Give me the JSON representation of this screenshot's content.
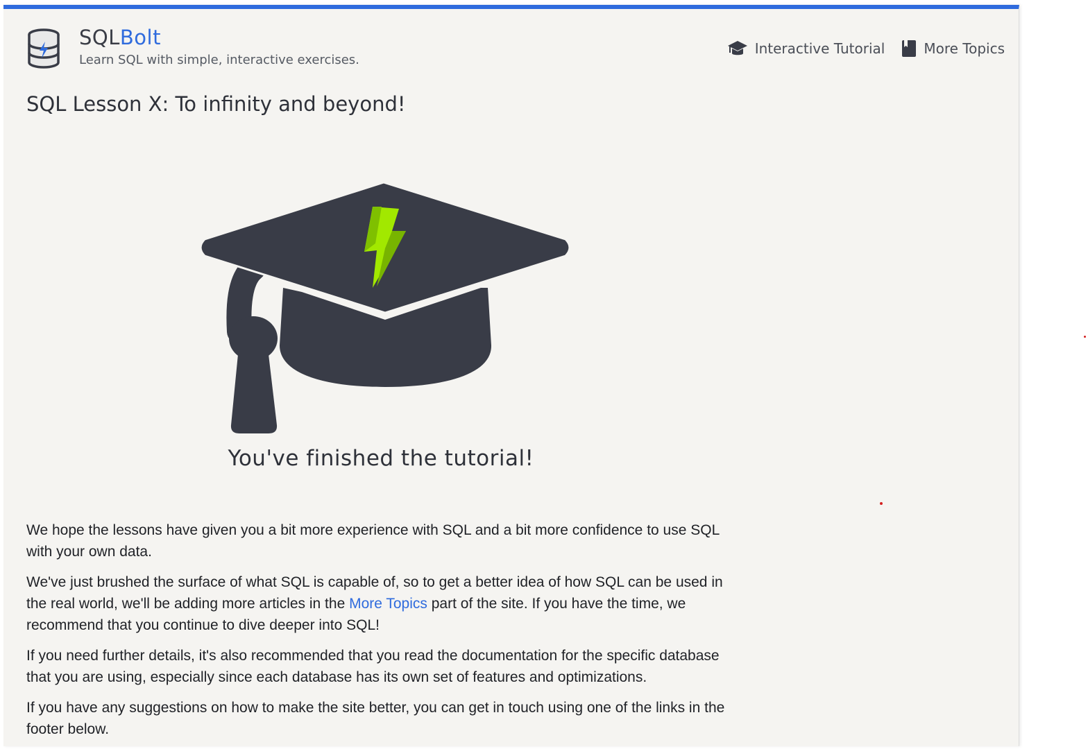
{
  "header": {
    "brand_sql": "SQL",
    "brand_bolt": "Bolt",
    "tagline": "Learn SQL with simple, interactive exercises.",
    "nav": [
      {
        "label": "Interactive Tutorial",
        "icon": "graduation-cap-icon"
      },
      {
        "label": "More Topics",
        "icon": "book-icon"
      }
    ]
  },
  "lesson": {
    "title": "SQL Lesson X: To infinity and beyond!",
    "finished_text": "You've finished the tutorial!"
  },
  "body": {
    "p1": "We hope the lessons have given you a bit more experience with SQL and a bit more confidence to use SQL with your own data.",
    "p2_before": "We've just brushed the surface of what SQL is capable of, so to get a better idea of how SQL can be used in the real world, we'll be adding more articles in the ",
    "p2_link": "More Topics",
    "p2_after": " part of the site. If you have the time, we recommend that you continue to dive deeper into SQL!",
    "p3": "If you need further details, it's also recommended that you read the documentation for the specific database that you are using, especially since each database has its own set of features and optimizations.",
    "p4": "If you have any suggestions on how to make the site better, you can get in touch using one of the links in the footer below."
  },
  "colors": {
    "accent": "#2f6bdd",
    "cap": "#393c47",
    "bolt": "#8fd400",
    "background": "#f5f4f1"
  }
}
